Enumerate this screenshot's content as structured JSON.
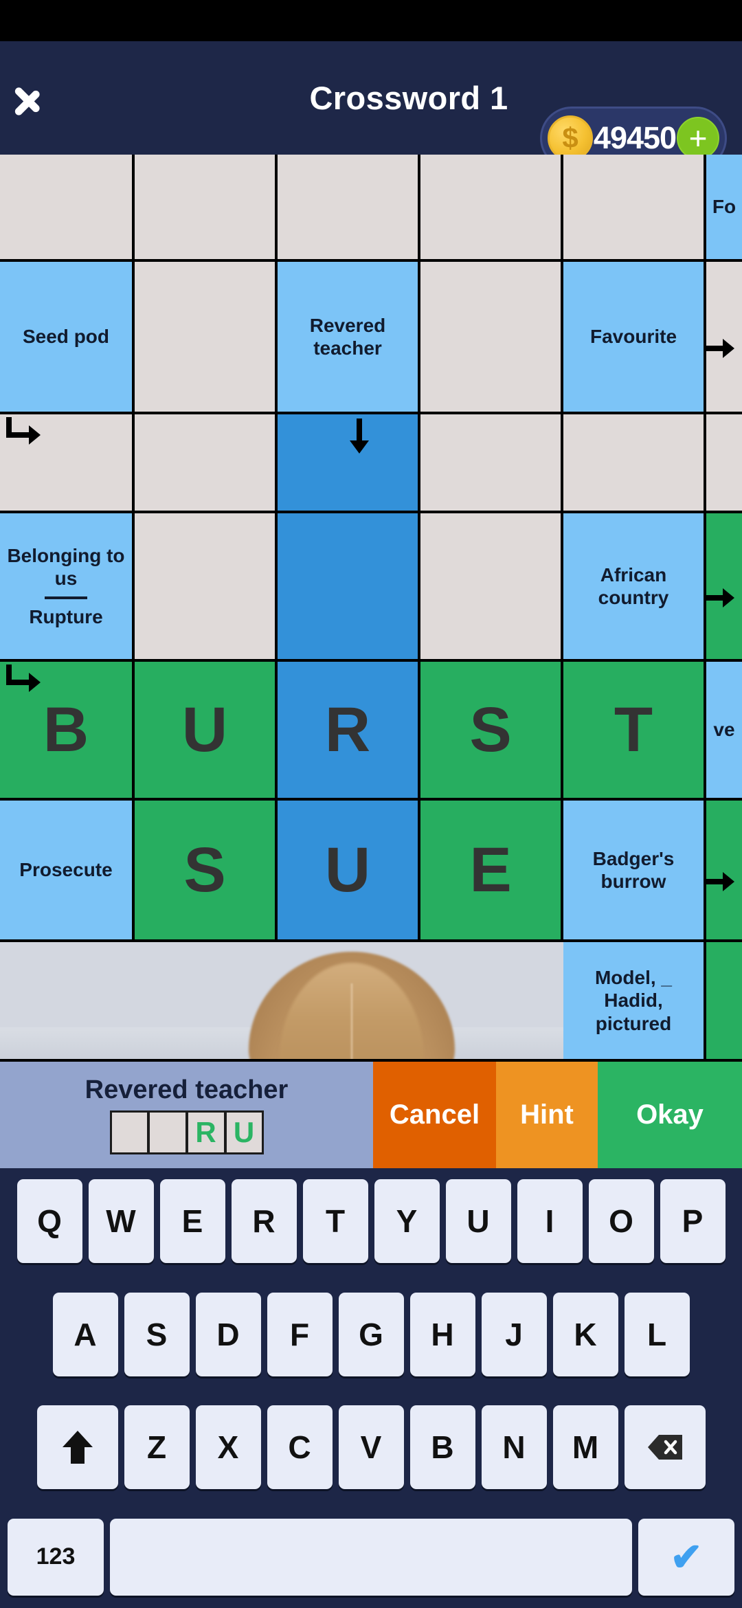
{
  "header": {
    "title": "Crossword 1",
    "back_icon": "back-chevron-icon",
    "coins": "49450",
    "coin_icon": "coin-icon",
    "plus_label": "+"
  },
  "grid": {
    "columns": 5,
    "rows": 7,
    "cells": [
      {
        "r": 0,
        "c": 0,
        "type": "empty",
        "text": ""
      },
      {
        "r": 0,
        "c": 1,
        "type": "empty",
        "text": ""
      },
      {
        "r": 0,
        "c": 2,
        "type": "empty",
        "text": ""
      },
      {
        "r": 0,
        "c": 3,
        "type": "empty",
        "text": ""
      },
      {
        "r": 0,
        "c": 4,
        "type": "empty",
        "text": ""
      },
      {
        "r": 0,
        "c": 5,
        "type": "clue",
        "text": "Fo"
      },
      {
        "r": 1,
        "c": 0,
        "type": "clue",
        "text": "Seed pod"
      },
      {
        "r": 1,
        "c": 1,
        "type": "empty",
        "text": ""
      },
      {
        "r": 1,
        "c": 2,
        "type": "clue",
        "text": "Revered teacher"
      },
      {
        "r": 1,
        "c": 3,
        "type": "empty",
        "text": ""
      },
      {
        "r": 1,
        "c": 4,
        "type": "clue",
        "text": "Favourite"
      },
      {
        "r": 1,
        "c": 5,
        "type": "empty",
        "text": "",
        "arrow": "right-in"
      },
      {
        "r": 2,
        "c": 0,
        "type": "empty",
        "text": "",
        "arrow": "elbow"
      },
      {
        "r": 2,
        "c": 1,
        "type": "empty",
        "text": ""
      },
      {
        "r": 2,
        "c": 2,
        "type": "sel",
        "text": "",
        "arrow": "down"
      },
      {
        "r": 2,
        "c": 3,
        "type": "empty",
        "text": ""
      },
      {
        "r": 2,
        "c": 4,
        "type": "empty",
        "text": ""
      },
      {
        "r": 2,
        "c": 5,
        "type": "empty",
        "text": ""
      },
      {
        "r": 3,
        "c": 0,
        "type": "clue",
        "text": "Belonging to us",
        "text2": "Rupture",
        "arrow": "right-out"
      },
      {
        "r": 3,
        "c": 1,
        "type": "empty",
        "text": ""
      },
      {
        "r": 3,
        "c": 2,
        "type": "sel",
        "text": ""
      },
      {
        "r": 3,
        "c": 3,
        "type": "empty",
        "text": ""
      },
      {
        "r": 3,
        "c": 4,
        "type": "clue",
        "text": "African country"
      },
      {
        "r": 3,
        "c": 5,
        "type": "filled",
        "text": "",
        "arrow": "right-in"
      },
      {
        "r": 4,
        "c": 0,
        "type": "filled",
        "text": "B",
        "arrow": "elbow"
      },
      {
        "r": 4,
        "c": 1,
        "type": "filled",
        "text": "U"
      },
      {
        "r": 4,
        "c": 2,
        "type": "sel",
        "text": "R"
      },
      {
        "r": 4,
        "c": 3,
        "type": "filled",
        "text": "S"
      },
      {
        "r": 4,
        "c": 4,
        "type": "filled",
        "text": "T"
      },
      {
        "r": 4,
        "c": 5,
        "type": "clue",
        "text": "ve"
      },
      {
        "r": 5,
        "c": 0,
        "type": "clue",
        "text": "Prosecute",
        "arrow": "right-out"
      },
      {
        "r": 5,
        "c": 1,
        "type": "filled",
        "text": "S"
      },
      {
        "r": 5,
        "c": 2,
        "type": "sel",
        "text": "U"
      },
      {
        "r": 5,
        "c": 3,
        "type": "filled",
        "text": "E"
      },
      {
        "r": 5,
        "c": 4,
        "type": "clue",
        "text": "Badger's burrow"
      },
      {
        "r": 5,
        "c": 5,
        "type": "filled",
        "text": "",
        "arrow": "right-in"
      },
      {
        "r": 6,
        "c": 0,
        "type": "photo",
        "text": "",
        "span": 5
      },
      {
        "r": 6,
        "c": 4,
        "type": "clue",
        "text": "Model, _ Hadid, pictured"
      },
      {
        "r": 6,
        "c": 5,
        "type": "filled",
        "text": ""
      }
    ]
  },
  "answer_bar": {
    "clue": "Revered teacher",
    "letters": [
      "",
      "",
      "R",
      "U"
    ],
    "cancel_label": "Cancel",
    "hint_label": "Hint",
    "okay_label": "Okay"
  },
  "keyboard": {
    "row1": [
      "Q",
      "W",
      "E",
      "R",
      "T",
      "Y",
      "U",
      "I",
      "O",
      "P"
    ],
    "row2": [
      "A",
      "S",
      "D",
      "F",
      "G",
      "H",
      "J",
      "K",
      "L"
    ],
    "row3": [
      "Z",
      "X",
      "C",
      "V",
      "B",
      "N",
      "M"
    ],
    "shift_icon": "shift-up-arrow-icon",
    "backspace_icon": "backspace-icon",
    "numbers_label": "123",
    "space_label": "",
    "enter_icon": "checkmark-icon"
  },
  "colors": {
    "header_bg": "#1e2748",
    "clue_blue": "#7cc4f7",
    "selected_blue": "#3391d9",
    "filled_green": "#27ae60",
    "empty_grey": "#e0dad9",
    "cancel_orange": "#e06000",
    "hint_orange": "#ee9322",
    "okay_green": "#2bb463",
    "coin_gold": "#f5c132",
    "plus_green": "#7dc520"
  }
}
